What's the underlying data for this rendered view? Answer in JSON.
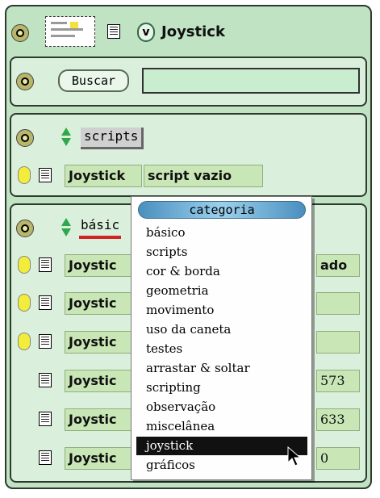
{
  "viewer": {
    "checkbox_label": "v",
    "title": "Joystick"
  },
  "search": {
    "button_label": "Buscar",
    "value": ""
  },
  "scripts_section": {
    "label": "scripts",
    "tiles": [
      "Joystick",
      "script vazio"
    ]
  },
  "basic_section": {
    "label": "básic",
    "rows": [
      {
        "tile": "Joystic",
        "value": "ado"
      },
      {
        "tile": "Joystic",
        "value": ""
      },
      {
        "tile": "Joystic",
        "value": ""
      },
      {
        "tile": "Joystic",
        "value": "573"
      },
      {
        "tile": "Joystic",
        "value": "633"
      },
      {
        "tile": "Joystic",
        "value": "0"
      }
    ]
  },
  "popup": {
    "title": "categoria",
    "items": [
      "básico",
      "scripts",
      "cor & borda",
      "geometria",
      "movimento",
      "uso da caneta",
      "testes",
      "arrastar & soltar",
      "scripting",
      "observação",
      "miscelânea",
      "joystick",
      "gráficos"
    ],
    "selected_index": 11
  },
  "colors": {
    "pane": "#bfe3c3",
    "section": "#dbf0dc",
    "tile": "#c9e7b6",
    "popup_header": "#6eb0d8",
    "selection": "#111111"
  }
}
